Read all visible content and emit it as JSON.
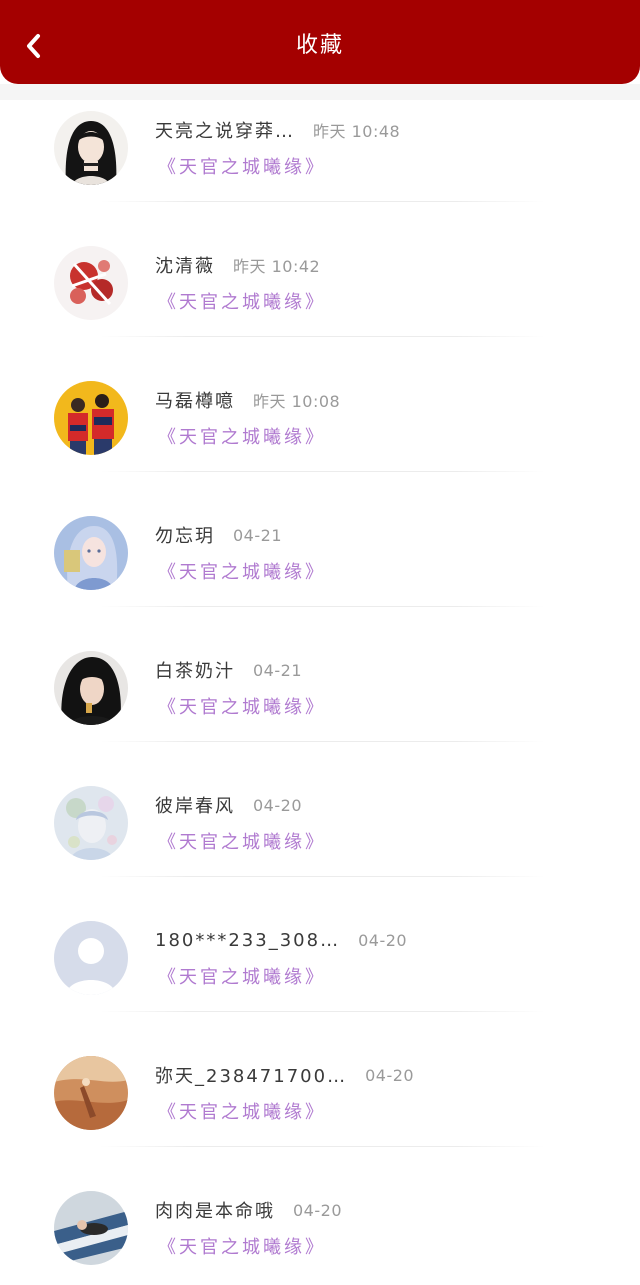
{
  "header": {
    "title": "收藏"
  },
  "items": [
    {
      "name": "天亮之说穿莽…",
      "time": "昨天 10:48",
      "book": "《天官之城曦缘》",
      "avatar": "avatar-girl-dark-hair"
    },
    {
      "name": "沈清薇",
      "time": "昨天 10:42",
      "book": "《天官之城曦缘》",
      "avatar": "avatar-red-flowers"
    },
    {
      "name": "马磊樽噫",
      "time": "昨天 10:08",
      "book": "《天官之城曦缘》",
      "avatar": "avatar-couple-yellow"
    },
    {
      "name": "勿忘玥",
      "time": "04-21",
      "book": "《天官之城曦缘》",
      "avatar": "avatar-anime-girl-blue"
    },
    {
      "name": "白茶奶汁",
      "time": "04-21",
      "book": "《天官之城曦缘》",
      "avatar": "avatar-dark-hair-portrait"
    },
    {
      "name": "彼岸春风",
      "time": "04-20",
      "book": "《天官之城曦缘》",
      "avatar": "avatar-pastel-illustration"
    },
    {
      "name": "180***233_308…",
      "time": "04-20",
      "book": "《天官之城曦缘》",
      "avatar": "avatar-default-person"
    },
    {
      "name": "弥天_238471700…",
      "time": "04-20",
      "book": "《天官之城曦缘》",
      "avatar": "avatar-desert-scene"
    },
    {
      "name": "肉肉是本命哦",
      "time": "04-20",
      "book": "《天官之城曦缘》",
      "avatar": "avatar-striped-photo"
    }
  ],
  "colors": {
    "header_bg": "#a40000",
    "book_text": "#b07ad0",
    "time_text": "#9a9a9a"
  }
}
